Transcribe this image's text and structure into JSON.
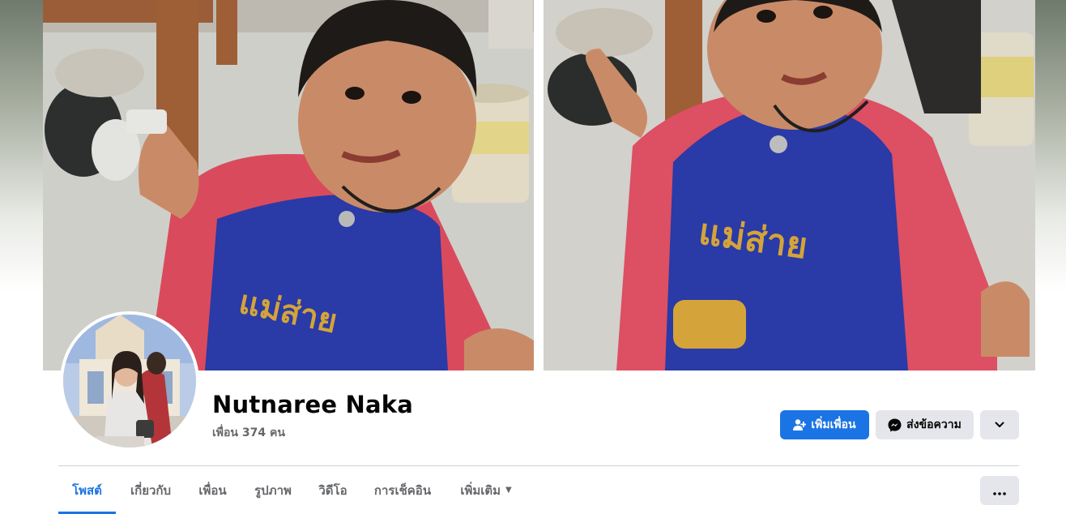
{
  "profile": {
    "name": "Nutnaree Naka",
    "friends_text": "เพื่อน 374 คน"
  },
  "actions": {
    "add_friend_label": "เพิ่มเพื่อน",
    "message_label": "ส่งข้อความ"
  },
  "tabs": [
    {
      "label": "โพสต์",
      "active": true
    },
    {
      "label": "เกี่ยวกับ",
      "active": false
    },
    {
      "label": "เพื่อน",
      "active": false
    },
    {
      "label": "รูปภาพ",
      "active": false
    },
    {
      "label": "วิดีโอ",
      "active": false
    },
    {
      "label": "การเช็คอิน",
      "active": false
    },
    {
      "label": "เพิ่มเติม",
      "active": false
    }
  ],
  "colors": {
    "accent": "#1b74e4",
    "secondary_button": "#e4e6eb",
    "muted_text": "#65676b",
    "shirt_print": "#d4a43a"
  },
  "cover_print_text": "แม่ส่าย"
}
